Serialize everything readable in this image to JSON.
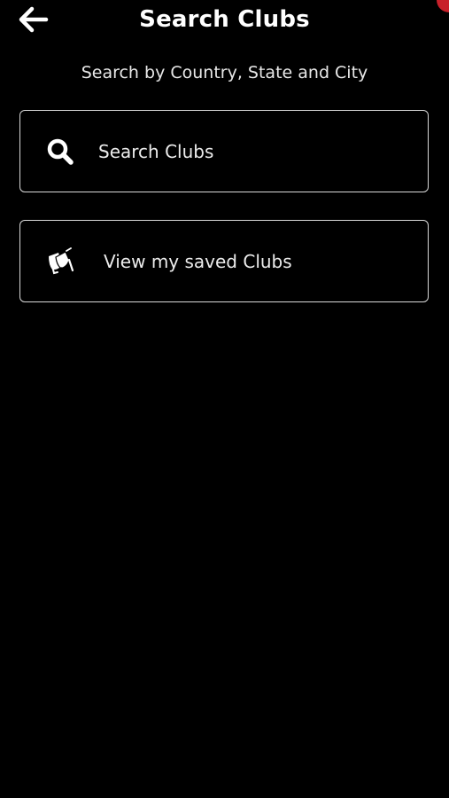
{
  "header": {
    "title": "Search Clubs",
    "back_icon": "arrow-left-icon"
  },
  "subtitle": "Search by Country, State and City",
  "menu": [
    {
      "label": "Search Clubs",
      "icon": "search-icon"
    },
    {
      "label": "View my saved Clubs",
      "icon": "cocktail-glasses-icon"
    }
  ],
  "colors": {
    "background": "#000000",
    "text": "#ffffff",
    "border": "#d9d9d9",
    "accent": "#c8202a"
  }
}
